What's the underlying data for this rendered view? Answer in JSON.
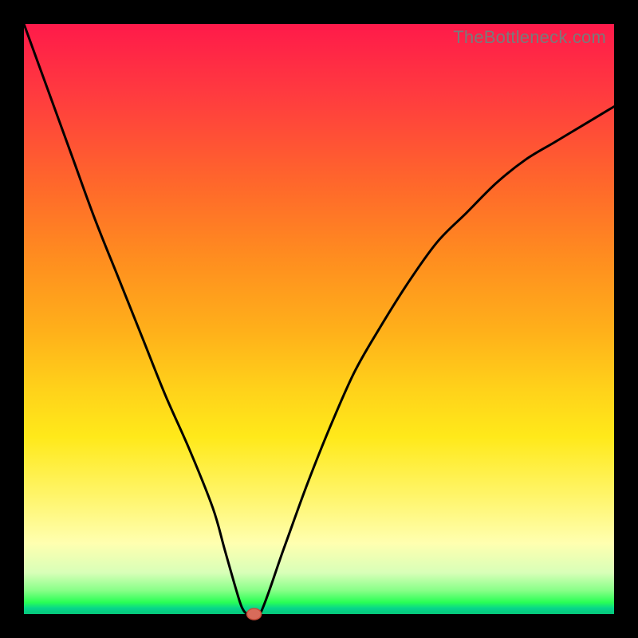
{
  "watermark": "TheBottleneck.com",
  "chart_data": {
    "type": "line",
    "title": "",
    "xlabel": "",
    "ylabel": "",
    "xlim": [
      0,
      100
    ],
    "ylim": [
      0,
      100
    ],
    "x": [
      0,
      4,
      8,
      12,
      16,
      20,
      24,
      28,
      32,
      34,
      36,
      37,
      38,
      40,
      44,
      48,
      52,
      56,
      60,
      65,
      70,
      75,
      80,
      85,
      90,
      95,
      100
    ],
    "values": [
      100,
      89,
      78,
      67,
      57,
      47,
      37,
      28,
      18,
      11,
      4,
      1,
      0,
      0,
      11,
      22,
      32,
      41,
      48,
      56,
      63,
      68,
      73,
      77,
      80,
      83,
      86
    ],
    "series_name": "bottleneck-curve",
    "marker": {
      "x": 39,
      "y": 0
    },
    "colors": {
      "top": "#ff1a4a",
      "mid_high": "#ff8e1f",
      "mid": "#ffe91a",
      "low": "#05c77a",
      "curve": "#000000",
      "marker_fill": "#d86b5a",
      "marker_stroke": "#c84b38"
    }
  }
}
